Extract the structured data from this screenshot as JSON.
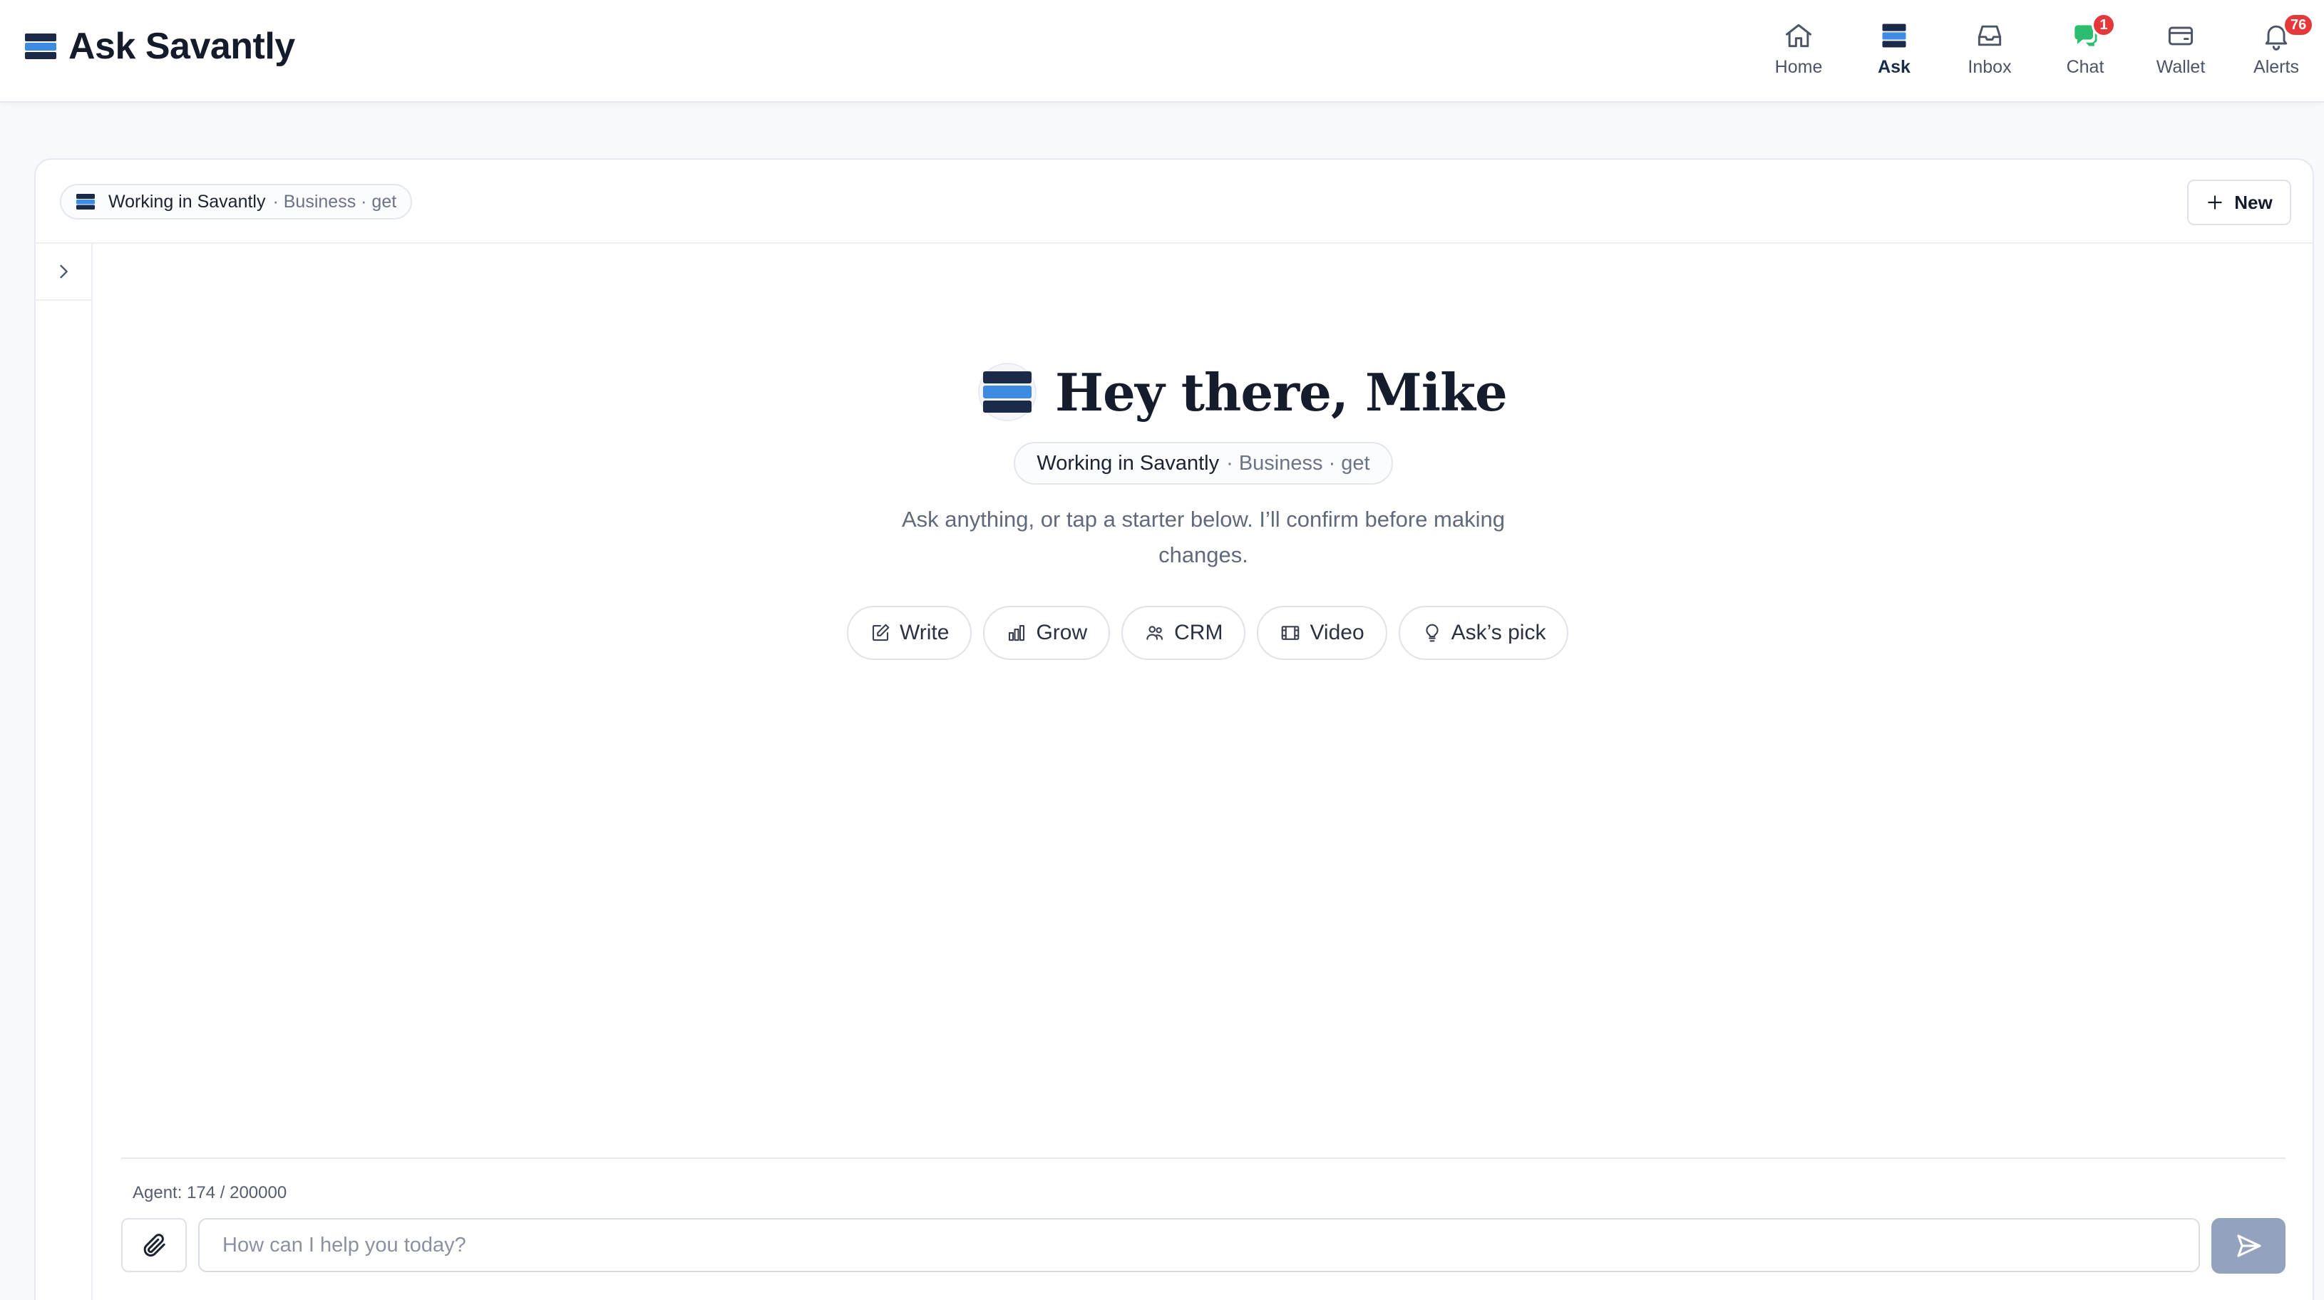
{
  "app": {
    "title": "Ask Savantly"
  },
  "nav": {
    "items": [
      {
        "key": "home",
        "label": "Home",
        "icon": "home-icon",
        "badge": ""
      },
      {
        "key": "ask",
        "label": "Ask",
        "icon": "savantly-logo-icon",
        "badge": "",
        "active": true
      },
      {
        "key": "inbox",
        "label": "Inbox",
        "icon": "inbox-icon",
        "badge": ""
      },
      {
        "key": "chat",
        "label": "Chat",
        "icon": "chat-icon",
        "badge": "1"
      },
      {
        "key": "wallet",
        "label": "Wallet",
        "icon": "wallet-icon",
        "badge": ""
      },
      {
        "key": "alerts",
        "label": "Alerts",
        "icon": "bell-icon",
        "badge": "76"
      }
    ]
  },
  "header": {
    "context": {
      "main": "Working in Savantly",
      "sub": "· Business · get"
    },
    "new_label": "New"
  },
  "hero": {
    "title": "Hey there, Mike",
    "context": {
      "main": "Working in Savantly",
      "sub": "· Business · get"
    },
    "subtitle": "Ask anything, or tap a starter below. I’ll confirm before making changes."
  },
  "starters": [
    {
      "label": "Write",
      "icon": "edit-icon"
    },
    {
      "label": "Grow",
      "icon": "bar-chart-icon"
    },
    {
      "label": "CRM",
      "icon": "users-icon"
    },
    {
      "label": "Video",
      "icon": "film-icon"
    },
    {
      "label": "Ask’s pick",
      "icon": "lightbulb-icon"
    }
  ],
  "composer": {
    "agent_usage": "Agent: 174 / 200000",
    "placeholder": "How can I help you today?",
    "value": ""
  },
  "colors": {
    "accent": "#1b2b4a",
    "logo_dark": "#1c2a4a",
    "logo_light": "#3d8be3",
    "badge": "#e5383b",
    "chat_green": "#2dbd6e",
    "send_disabled": "#93a2bd"
  }
}
